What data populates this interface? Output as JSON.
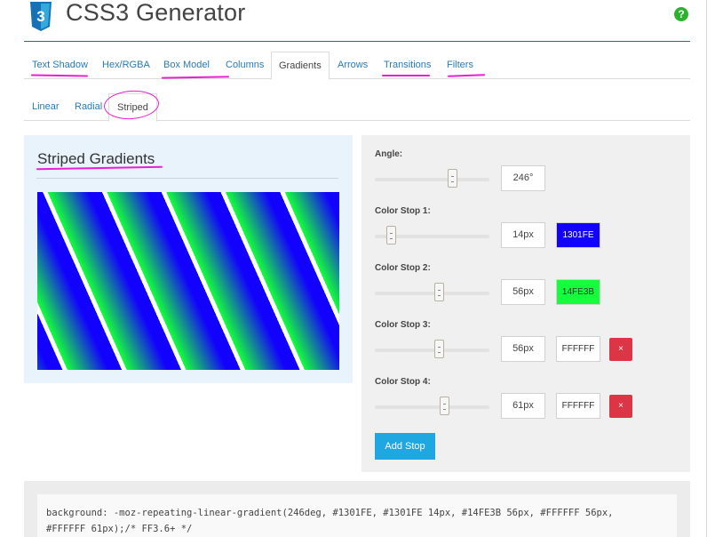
{
  "header": {
    "title": "CSS3 Generator",
    "help": "?",
    "logo_icon": "css3-shield-icon"
  },
  "main_tabs": [
    {
      "label": "Text Shadow"
    },
    {
      "label": "Hex/RGBA"
    },
    {
      "label": "Box Model"
    },
    {
      "label": "Columns"
    },
    {
      "label": "Gradients",
      "active": true
    },
    {
      "label": "Arrows"
    },
    {
      "label": "Transitions"
    },
    {
      "label": "Filters"
    }
  ],
  "sub_tabs": [
    {
      "label": "Linear"
    },
    {
      "label": "Radial"
    },
    {
      "label": "Striped",
      "active": true
    }
  ],
  "preview": {
    "title": "Striped Gradients",
    "gradient": {
      "angle": 246,
      "stops": [
        {
          "color": "#1301FE",
          "pos": 14
        },
        {
          "color": "#14FE3B",
          "pos": 56
        },
        {
          "color": "#FFFFFF",
          "pos": 56
        },
        {
          "color": "#FFFFFF",
          "pos": 61
        }
      ]
    }
  },
  "controls": {
    "angle": {
      "label": "Angle:",
      "value": "246°",
      "slider": 0.68
    },
    "stops": [
      {
        "label": "Color Stop 1:",
        "value": "14px",
        "color": "1301FE",
        "bg": "#1301FE",
        "fg": "#ffffff",
        "slider": 0.14,
        "removable": false
      },
      {
        "label": "Color Stop 2:",
        "value": "56px",
        "color": "14FE3B",
        "bg": "#14FE3B",
        "fg": "#333333",
        "slider": 0.56,
        "removable": false
      },
      {
        "label": "Color Stop 3:",
        "value": "56px",
        "color": "FFFFFF",
        "bg": "#FFFFFF",
        "fg": "#333333",
        "slider": 0.56,
        "removable": true
      },
      {
        "label": "Color Stop 4:",
        "value": "61px",
        "color": "FFFFFF",
        "bg": "#FFFFFF",
        "fg": "#333333",
        "slider": 0.61,
        "removable": true
      }
    ],
    "remove_label": "×",
    "add_stop": "Add Stop"
  },
  "code": {
    "line1": "background: -moz-repeating-linear-gradient(246deg, #1301FE, #1301FE 14px, #14FE3B 56px, #FFFFFF 56px,",
    "line2": "#FFFFFF 61px);/* FF3.6+ */"
  },
  "colors": {
    "link": "#2a7ab8",
    "annotation": "#e81fd6",
    "add_button": "#1ea7e0",
    "remove_button": "#dc3545",
    "header_rule": "#2a6f68"
  }
}
